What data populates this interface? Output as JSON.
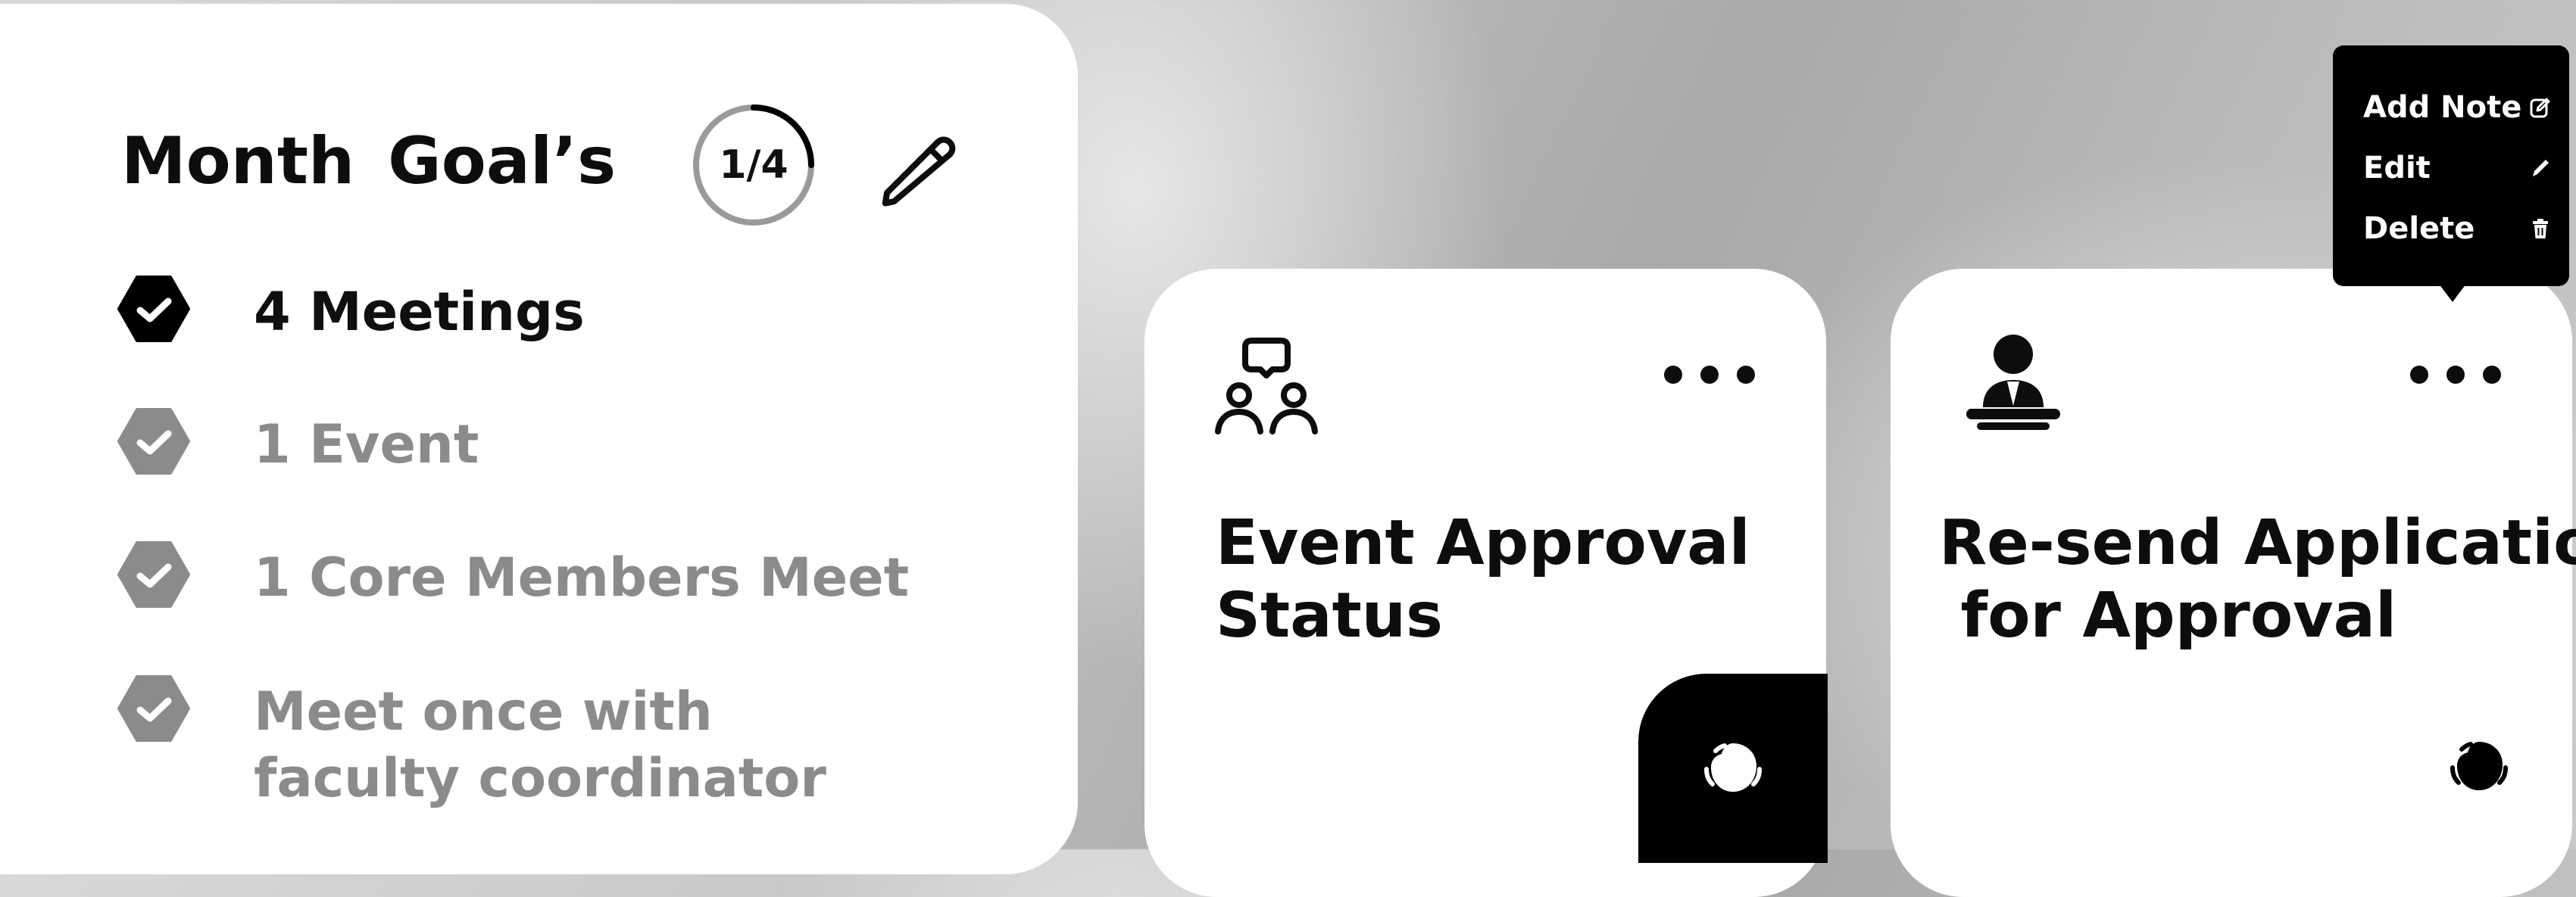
{
  "goals": {
    "title": "Month  Goal’s",
    "progress_text": "1/4",
    "progress_fraction": 0.25,
    "items": [
      {
        "label": "4 Meetings",
        "status": "done"
      },
      {
        "label": "1 Event",
        "status": "pending"
      },
      {
        "label": "1 Core Members Meet",
        "status": "pending"
      },
      {
        "label": "Meet once with\nfaculty coordinator",
        "status": "pending"
      }
    ],
    "icons": {
      "edit": "pencil-icon",
      "check": "hexagon-check-icon"
    }
  },
  "cards": [
    {
      "title": "Event Approval\nStatus",
      "icon": "meeting-chat-icon",
      "corner_icon": "bug-icon",
      "corner_highlight": true
    },
    {
      "title": "Re-send Application\n for Approval",
      "icon": "presenter-podium-icon",
      "corner_icon": "bug-icon",
      "corner_highlight": false
    }
  ],
  "context_menu": {
    "items": [
      {
        "label": "Add Note",
        "icon": "note-edit-icon"
      },
      {
        "label": "Edit",
        "icon": "pen-icon"
      },
      {
        "label": "Delete",
        "icon": "trash-icon"
      }
    ]
  },
  "colors": {
    "card_bg": "#ffffff",
    "text_primary": "#0d0d0d",
    "text_muted": "#8b8b8b",
    "menu_bg": "#000000",
    "check_done": "#000000",
    "check_pending": "#8b8b8b",
    "ring_track": "#9a9a9a",
    "ring_progress": "#000000"
  }
}
